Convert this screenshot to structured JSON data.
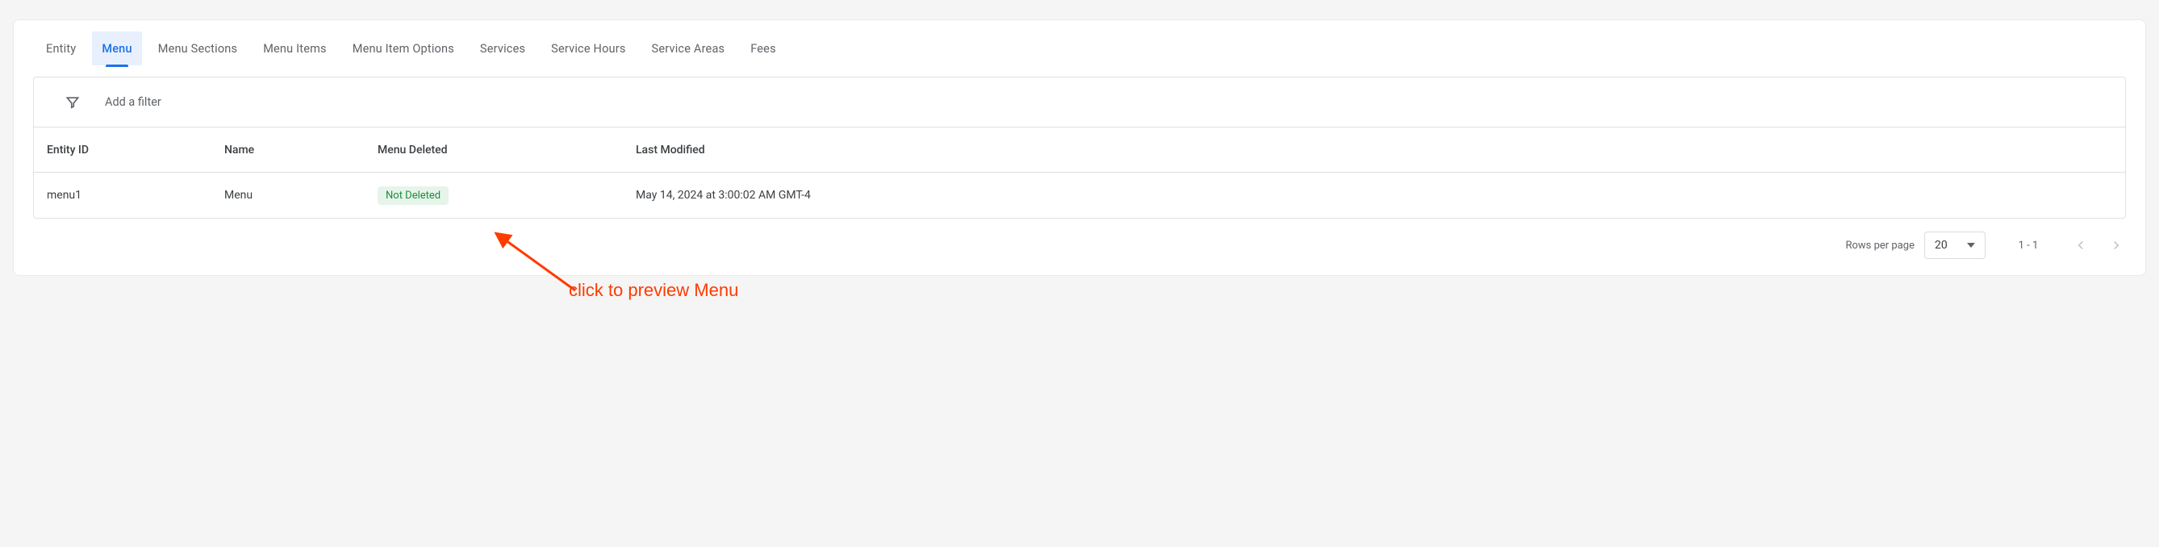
{
  "tabs": [
    {
      "label": "Entity"
    },
    {
      "label": "Menu"
    },
    {
      "label": "Menu Sections"
    },
    {
      "label": "Menu Items"
    },
    {
      "label": "Menu Item Options"
    },
    {
      "label": "Services"
    },
    {
      "label": "Service Hours"
    },
    {
      "label": "Service Areas"
    },
    {
      "label": "Fees"
    }
  ],
  "active_tab_index": 1,
  "filter": {
    "placeholder": "Add a filter"
  },
  "table": {
    "columns": [
      "Entity ID",
      "Name",
      "Menu Deleted",
      "Last Modified"
    ],
    "rows": [
      {
        "entity_id": "menu1",
        "name": "Menu",
        "menu_deleted_badge": "Not Deleted",
        "last_modified": "May 14, 2024 at 3:00:02 AM GMT-4"
      }
    ]
  },
  "pagination": {
    "rows_per_page_label": "Rows per page",
    "rows_per_page_value": "20",
    "range": "1 - 1"
  },
  "annotation": {
    "text": "click to preview Menu"
  },
  "colors": {
    "accent": "#1a73e8",
    "annotation": "#ff3b00",
    "badge_bg": "#e6f4ea",
    "badge_fg": "#1e8e3e"
  }
}
